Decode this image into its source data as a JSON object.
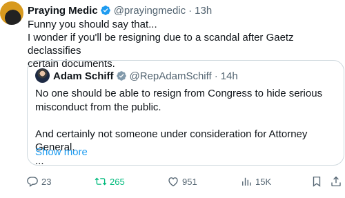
{
  "tweet": {
    "author": {
      "name": "Praying Medic",
      "handle": "@prayingmedic",
      "time": "13h"
    },
    "separator": "·",
    "lines": [
      "Funny you should say that...",
      "I wonder if you'll be resigning due to a scandal after Gaetz declassifies",
      "certain documents."
    ]
  },
  "quote": {
    "author": {
      "name": "Adam Schiff",
      "handle": "@RepAdamSchiff",
      "time": "14h"
    },
    "separator": "·",
    "paragraph1_lines": [
      "No one should be able to resign from Congress to hide serious",
      "misconduct from the public."
    ],
    "paragraph2_lines": [
      "And certainly not someone under consideration for Attorney General.",
      "..."
    ],
    "show_more": "Show more"
  },
  "actions": {
    "replies": "23",
    "retweets": "265",
    "likes": "951",
    "views": "15K"
  },
  "colors": {
    "text": "#0f1419",
    "muted": "#536471",
    "link": "#1d9bf0",
    "verified": "#1d9bf0",
    "verified_gray": "#829aab",
    "retweet": "#00ba7c",
    "border": "#cfd9de"
  },
  "icons": [
    "verified-badge-icon",
    "reply-icon",
    "retweet-icon",
    "like-icon",
    "views-icon",
    "bookmark-icon",
    "share-icon"
  ]
}
